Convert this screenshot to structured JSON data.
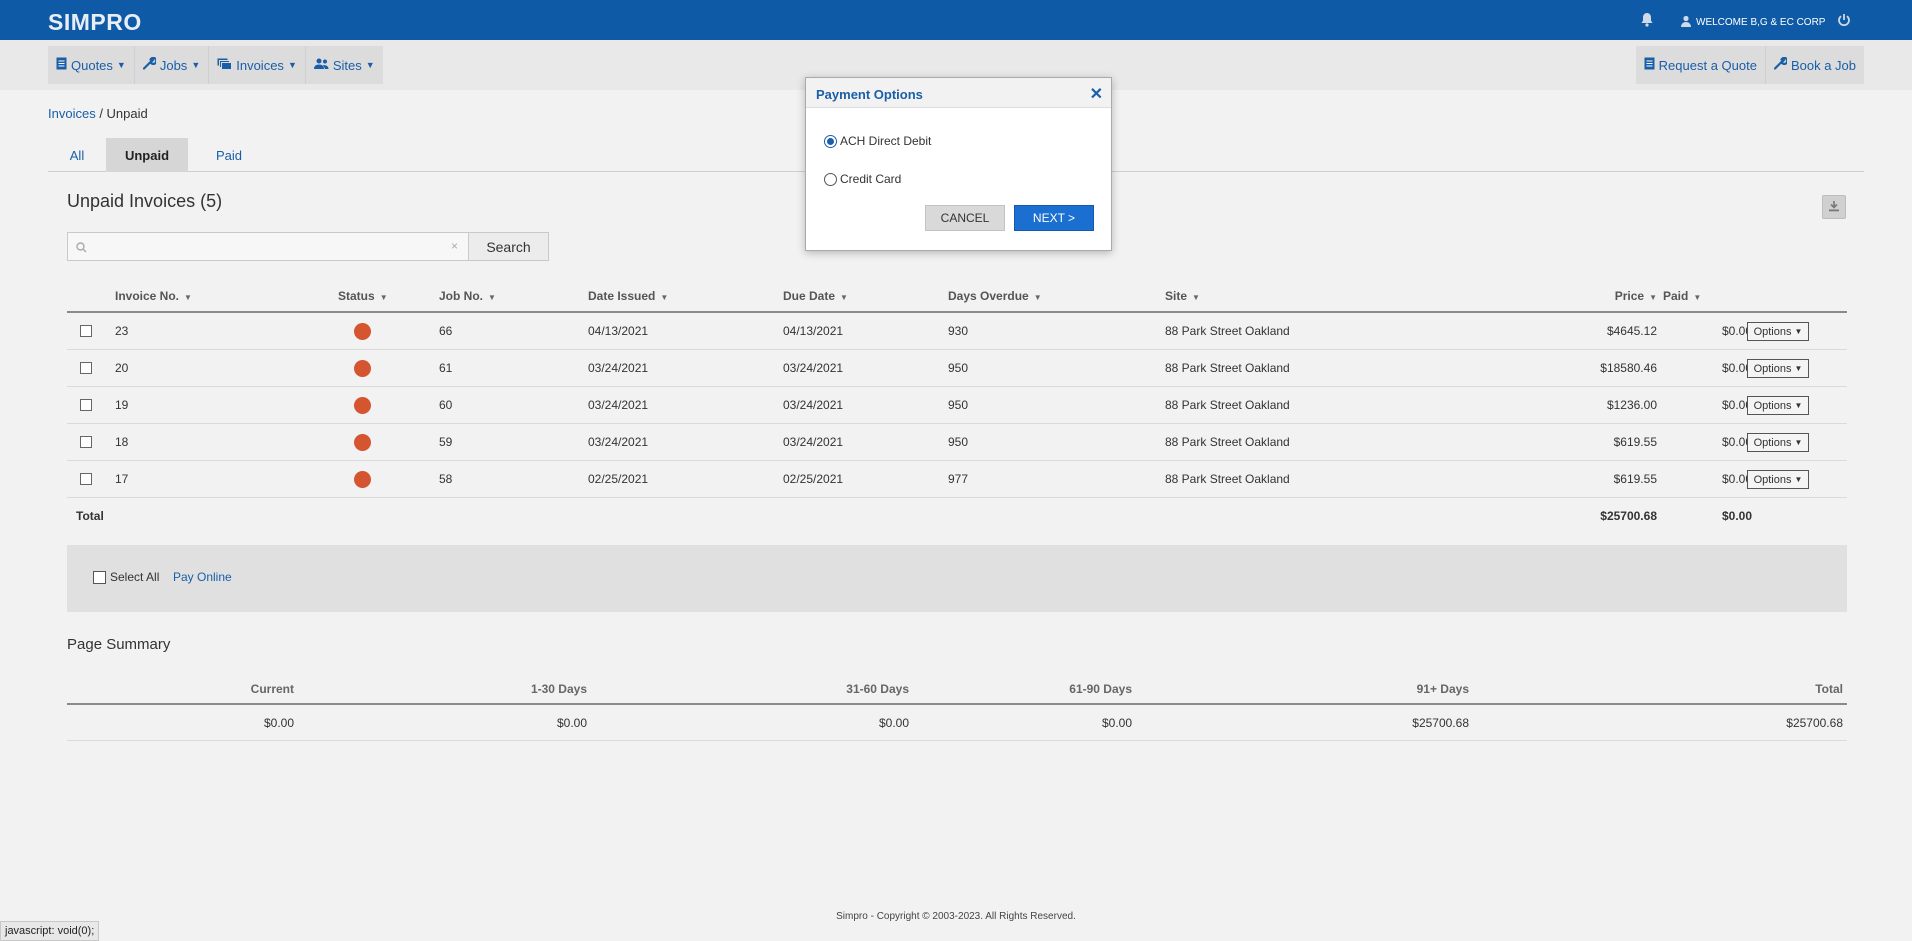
{
  "app": {
    "logo": "SIMPRO",
    "welcome": "WELCOME B,G & EC CORP"
  },
  "nav": {
    "left": [
      {
        "label": "Quotes",
        "icon": "document-icon"
      },
      {
        "label": "Jobs",
        "icon": "wrench-icon"
      },
      {
        "label": "Invoices",
        "icon": "money-icon"
      },
      {
        "label": "Sites",
        "icon": "users-icon"
      }
    ],
    "right": [
      {
        "label": "Request a Quote",
        "icon": "document-icon"
      },
      {
        "label": "Book a Job",
        "icon": "wrench-icon"
      }
    ]
  },
  "breadcrumb": {
    "parent": "Invoices",
    "separator": " / ",
    "current": "Unpaid"
  },
  "tabs": [
    {
      "label": "All",
      "active": false
    },
    {
      "label": "Unpaid",
      "active": true
    },
    {
      "label": "Paid",
      "active": false
    }
  ],
  "section_title": "Unpaid Invoices (5)",
  "search": {
    "value": "",
    "placeholder": "",
    "button": "Search",
    "clear": "×"
  },
  "table": {
    "headers": [
      "Invoice No.",
      "Status",
      "Job No.",
      "Date Issued",
      "Due Date",
      "Days Overdue",
      "Site",
      "Price",
      "Paid"
    ],
    "rows": [
      {
        "invoice": "23",
        "status_color": "#d4552f",
        "job": "66",
        "issued": "04/13/2021",
        "due": "04/13/2021",
        "overdue": "930",
        "site": "88 Park Street Oakland",
        "price": "$4645.12",
        "paid": "$0.00",
        "options": "Options"
      },
      {
        "invoice": "20",
        "status_color": "#d4552f",
        "job": "61",
        "issued": "03/24/2021",
        "due": "03/24/2021",
        "overdue": "950",
        "site": "88 Park Street Oakland",
        "price": "$18580.46",
        "paid": "$0.00",
        "options": "Options"
      },
      {
        "invoice": "19",
        "status_color": "#d4552f",
        "job": "60",
        "issued": "03/24/2021",
        "due": "03/24/2021",
        "overdue": "950",
        "site": "88 Park Street Oakland",
        "price": "$1236.00",
        "paid": "$0.00",
        "options": "Options"
      },
      {
        "invoice": "18",
        "status_color": "#d4552f",
        "job": "59",
        "issued": "03/24/2021",
        "due": "03/24/2021",
        "overdue": "950",
        "site": "88 Park Street Oakland",
        "price": "$619.55",
        "paid": "$0.00",
        "options": "Options"
      },
      {
        "invoice": "17",
        "status_color": "#d4552f",
        "job": "58",
        "issued": "02/25/2021",
        "due": "02/25/2021",
        "overdue": "977",
        "site": "88 Park Street Oakland",
        "price": "$619.55",
        "paid": "$0.00",
        "options": "Options"
      }
    ],
    "total": {
      "label": "Total",
      "price": "$25700.68",
      "paid": "$0.00"
    }
  },
  "actions": {
    "select_all": "Select All",
    "pay_online": "Pay Online"
  },
  "summary": {
    "title": "Page Summary",
    "headers": [
      "Current",
      "1-30 Days",
      "31-60 Days",
      "61-90 Days",
      "91+ Days",
      "Total"
    ],
    "values": [
      "$0.00",
      "$0.00",
      "$0.00",
      "$0.00",
      "$25700.68",
      "$25700.68"
    ]
  },
  "footer": "Simpro - Copyright © 2003-2023. All Rights Reserved.",
  "status_url": "javascript: void(0);",
  "modal": {
    "title": "Payment Options",
    "options": [
      {
        "label": "ACH Direct Debit",
        "selected": true
      },
      {
        "label": "Credit Card",
        "selected": false
      }
    ],
    "cancel": "CANCEL",
    "next": "NEXT >"
  },
  "colors": {
    "topbar": "#0f5aa6",
    "link": "#1a5ea8",
    "primary_button": "#1a6fd0",
    "status_overdue": "#d4552f"
  }
}
